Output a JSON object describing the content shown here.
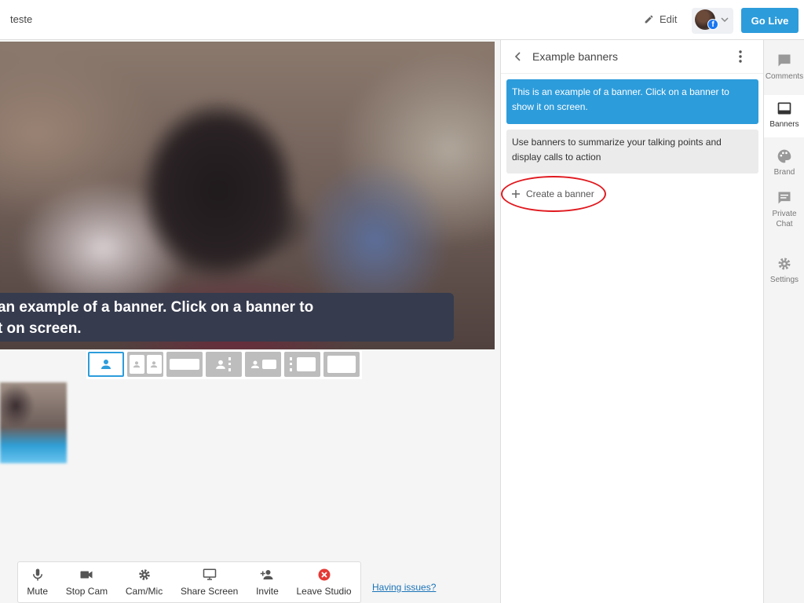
{
  "header": {
    "title": "teste",
    "edit_label": "Edit",
    "go_live_label": "Go Live"
  },
  "stage": {
    "banner_text": "This is an example of a banner. Click on a banner to show it on screen.",
    "banner_line1": "s is an example of a banner. Click on a banner to",
    "banner_line2": "ow it on screen."
  },
  "toolbar": {
    "mute": "Mute",
    "stop_cam": "Stop Cam",
    "cam_mic": "Cam/Mic",
    "share_screen": "Share Screen",
    "invite": "Invite",
    "leave_studio": "Leave Studio",
    "having_issues": "Having issues?"
  },
  "panel": {
    "title": "Example banners",
    "banners": [
      "This is an example of a banner. Click on a banner to show it on screen.",
      "Use banners to summarize your talking points and display calls to action"
    ],
    "create_label": "Create a banner"
  },
  "rail": {
    "comments": "Comments",
    "banners": "Banners",
    "brand": "Brand",
    "private_chat": "Private Chat",
    "settings": "Settings"
  },
  "colors": {
    "accent": "#2d9cdb",
    "banner_bg": "#363b4e",
    "highlight": "#e0191f",
    "leave": "#e53935"
  }
}
